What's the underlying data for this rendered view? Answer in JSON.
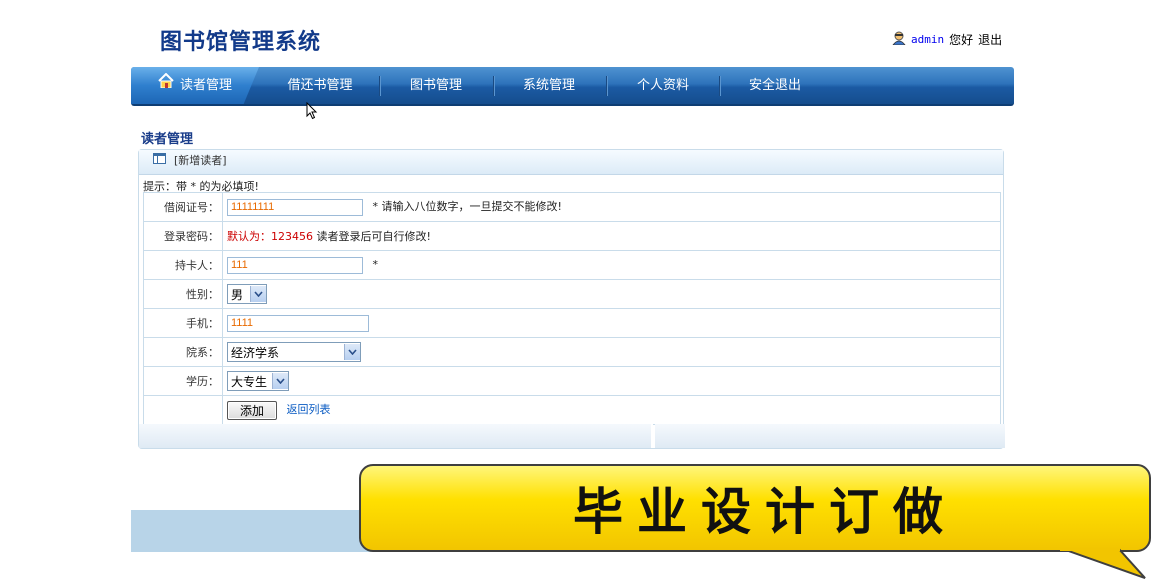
{
  "header": {
    "title": "图书馆管理系统",
    "username": "admin",
    "greeting": "您好",
    "logout": "退出"
  },
  "nav": {
    "items": [
      "读者管理",
      "借还书管理",
      "图书管理",
      "系统管理",
      "个人资料",
      "安全退出"
    ],
    "active": 0
  },
  "page": {
    "section_title": "读者管理",
    "panel_title": "[新增读者]",
    "hint": "提示：带 * 的为必填项!"
  },
  "form": {
    "card_no": {
      "label": "借阅证号：",
      "value": "11111111",
      "note": "* 请输入八位数字，一旦提交不能修改!"
    },
    "password": {
      "label": "登录密码：",
      "default_text": "默认为：123456",
      "note": "读者登录后可自行修改!"
    },
    "holder": {
      "label": "持卡人：",
      "value": "111",
      "note": "*"
    },
    "gender": {
      "label": "性别：",
      "selected": "男"
    },
    "phone": {
      "label": "手机：",
      "value": "1111"
    },
    "dept": {
      "label": "院系：",
      "selected": "经济学系"
    },
    "edu": {
      "label": "学历：",
      "selected": "大专生"
    },
    "submit_label": "添加",
    "back_label": "返回列表"
  },
  "banner": {
    "text": "毕业设计订做"
  },
  "colors": {
    "nav_blue": "#2e73bb",
    "title_blue": "#123a8a",
    "banner_yellow": "#ffe000",
    "required_red": "#cc0000"
  }
}
